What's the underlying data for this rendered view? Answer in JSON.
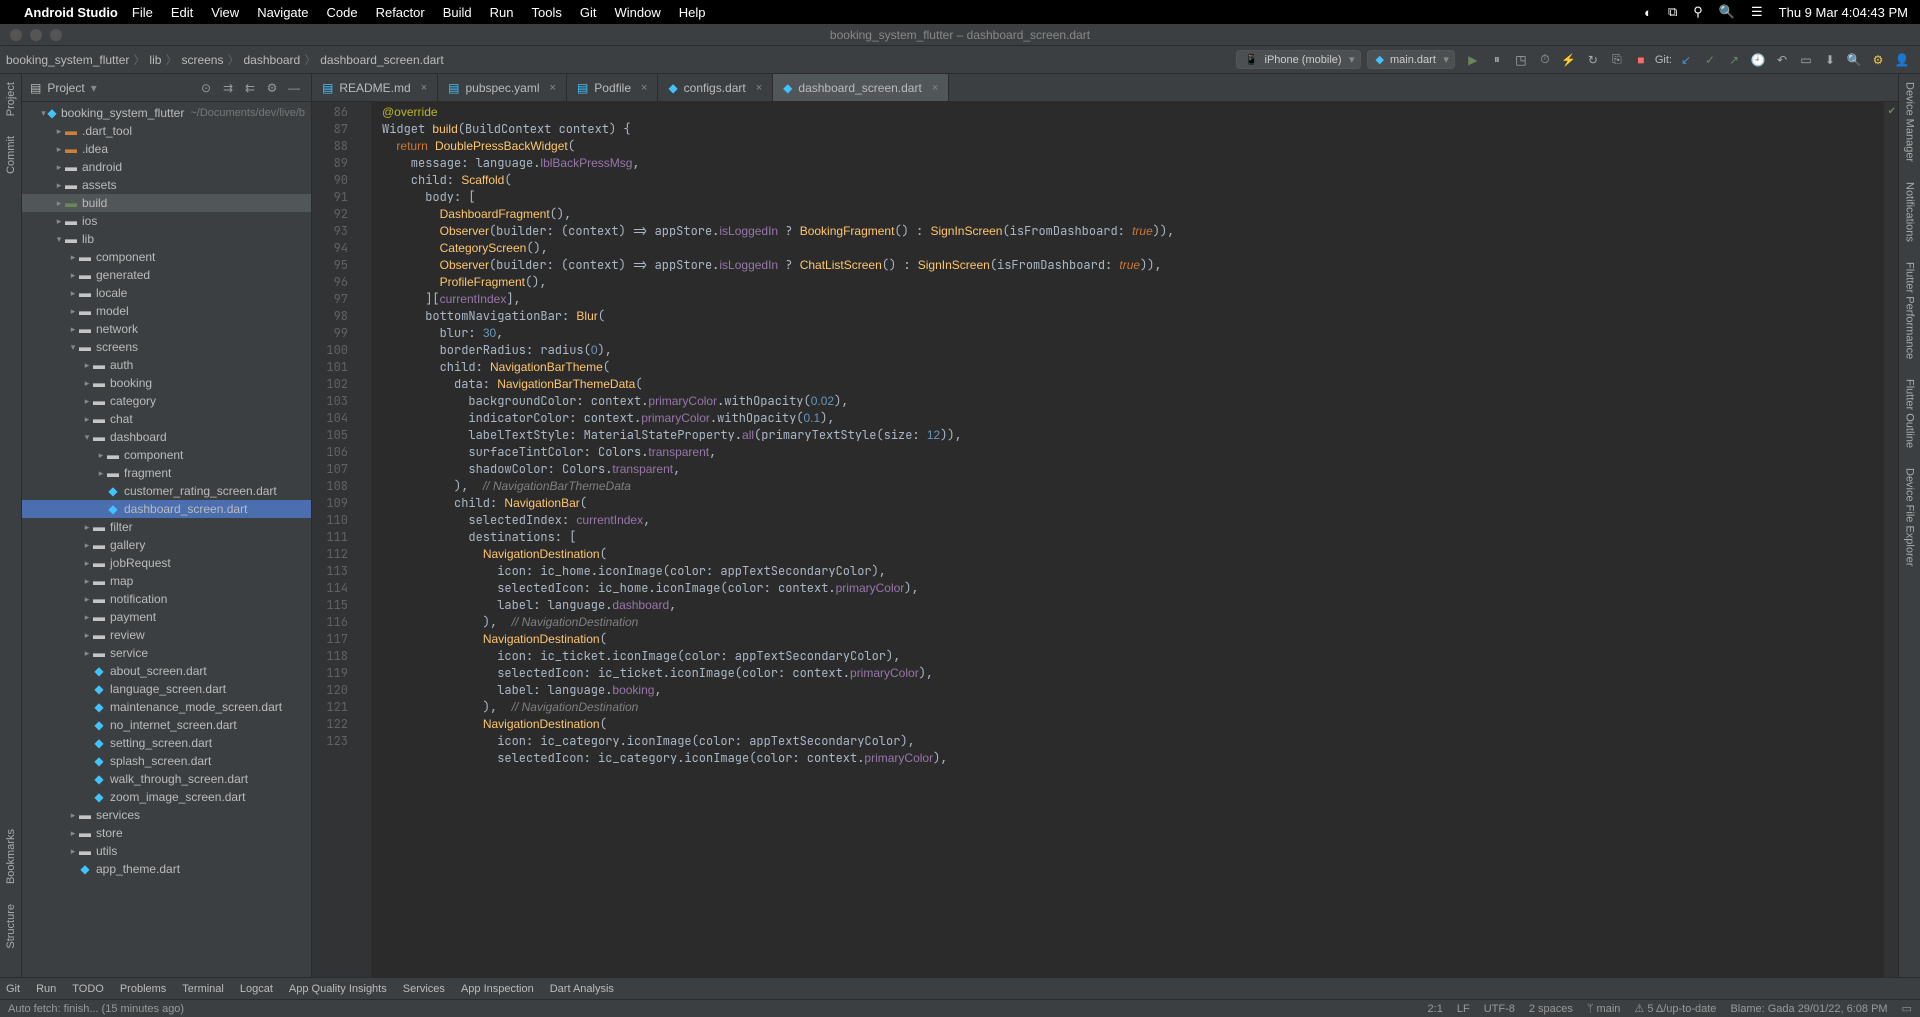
{
  "menubar": {
    "appname": "Android Studio",
    "items": [
      "File",
      "Edit",
      "View",
      "Navigate",
      "Code",
      "Refactor",
      "Build",
      "Run",
      "Tools",
      "Git",
      "Window",
      "Help"
    ],
    "clock": "Thu 9 Mar 4:04:43 PM"
  },
  "window_title": "booking_system_flutter – dashboard_screen.dart",
  "breadcrumbs": [
    "booking_system_flutter",
    "lib",
    "screens",
    "dashboard",
    "dashboard_screen.dart"
  ],
  "device_selector": "iPhone (mobile)",
  "config_selector": "main.dart",
  "git_label": "Git:",
  "left_tool_labels": [
    "Project",
    "Commit"
  ],
  "right_tool_labels": [
    "Device Manager",
    "Notifications",
    "Flutter Performance",
    "Flutter Outline",
    "Device File Explorer"
  ],
  "project_panel": {
    "title": "Project",
    "root_name": "booking_system_flutter",
    "root_path": "~/Documents/dev/live/b",
    "tree": [
      {
        "depth": 1,
        "arrow": "▾",
        "icon": "flutter",
        "name": "booking_system_flutter",
        "path": "~/Documents/dev/live/b"
      },
      {
        "depth": 2,
        "arrow": "▸",
        "icon": "folder-o",
        "name": ".dart_tool"
      },
      {
        "depth": 2,
        "arrow": "▸",
        "icon": "folder-o",
        "name": ".idea"
      },
      {
        "depth": 2,
        "arrow": "▸",
        "icon": "folder",
        "name": "android"
      },
      {
        "depth": 2,
        "arrow": "▸",
        "icon": "folder",
        "name": "assets"
      },
      {
        "depth": 2,
        "arrow": "▸",
        "icon": "folder-g",
        "name": "build",
        "hl": true
      },
      {
        "depth": 2,
        "arrow": "▸",
        "icon": "folder",
        "name": "ios"
      },
      {
        "depth": 2,
        "arrow": "▾",
        "icon": "folder",
        "name": "lib"
      },
      {
        "depth": 3,
        "arrow": "▸",
        "icon": "folder",
        "name": "component"
      },
      {
        "depth": 3,
        "arrow": "▸",
        "icon": "folder",
        "name": "generated"
      },
      {
        "depth": 3,
        "arrow": "▸",
        "icon": "folder",
        "name": "locale"
      },
      {
        "depth": 3,
        "arrow": "▸",
        "icon": "folder",
        "name": "model"
      },
      {
        "depth": 3,
        "arrow": "▸",
        "icon": "folder",
        "name": "network"
      },
      {
        "depth": 3,
        "arrow": "▾",
        "icon": "folder",
        "name": "screens"
      },
      {
        "depth": 4,
        "arrow": "▸",
        "icon": "folder",
        "name": "auth"
      },
      {
        "depth": 4,
        "arrow": "▸",
        "icon": "folder",
        "name": "booking"
      },
      {
        "depth": 4,
        "arrow": "▸",
        "icon": "folder",
        "name": "category"
      },
      {
        "depth": 4,
        "arrow": "▸",
        "icon": "folder",
        "name": "chat"
      },
      {
        "depth": 4,
        "arrow": "▾",
        "icon": "folder",
        "name": "dashboard"
      },
      {
        "depth": 5,
        "arrow": "▸",
        "icon": "folder",
        "name": "component"
      },
      {
        "depth": 5,
        "arrow": "▸",
        "icon": "folder",
        "name": "fragment"
      },
      {
        "depth": 5,
        "arrow": " ",
        "icon": "dart",
        "name": "customer_rating_screen.dart"
      },
      {
        "depth": 5,
        "arrow": " ",
        "icon": "dart",
        "name": "dashboard_screen.dart",
        "selected": true
      },
      {
        "depth": 4,
        "arrow": "▸",
        "icon": "folder",
        "name": "filter"
      },
      {
        "depth": 4,
        "arrow": "▸",
        "icon": "folder",
        "name": "gallery"
      },
      {
        "depth": 4,
        "arrow": "▸",
        "icon": "folder",
        "name": "jobRequest"
      },
      {
        "depth": 4,
        "arrow": "▸",
        "icon": "folder",
        "name": "map"
      },
      {
        "depth": 4,
        "arrow": "▸",
        "icon": "folder",
        "name": "notification"
      },
      {
        "depth": 4,
        "arrow": "▸",
        "icon": "folder",
        "name": "payment"
      },
      {
        "depth": 4,
        "arrow": "▸",
        "icon": "folder",
        "name": "review"
      },
      {
        "depth": 4,
        "arrow": "▸",
        "icon": "folder",
        "name": "service"
      },
      {
        "depth": 4,
        "arrow": " ",
        "icon": "dart",
        "name": "about_screen.dart"
      },
      {
        "depth": 4,
        "arrow": " ",
        "icon": "dart",
        "name": "language_screen.dart"
      },
      {
        "depth": 4,
        "arrow": " ",
        "icon": "dart",
        "name": "maintenance_mode_screen.dart"
      },
      {
        "depth": 4,
        "arrow": " ",
        "icon": "dart",
        "name": "no_internet_screen.dart"
      },
      {
        "depth": 4,
        "arrow": " ",
        "icon": "dart",
        "name": "setting_screen.dart"
      },
      {
        "depth": 4,
        "arrow": " ",
        "icon": "dart",
        "name": "splash_screen.dart"
      },
      {
        "depth": 4,
        "arrow": " ",
        "icon": "dart",
        "name": "walk_through_screen.dart"
      },
      {
        "depth": 4,
        "arrow": " ",
        "icon": "dart",
        "name": "zoom_image_screen.dart"
      },
      {
        "depth": 3,
        "arrow": "▸",
        "icon": "folder",
        "name": "services"
      },
      {
        "depth": 3,
        "arrow": "▸",
        "icon": "folder",
        "name": "store"
      },
      {
        "depth": 3,
        "arrow": "▸",
        "icon": "folder",
        "name": "utils"
      },
      {
        "depth": 3,
        "arrow": " ",
        "icon": "dart",
        "name": "app_theme.dart"
      }
    ]
  },
  "editor_tabs": [
    {
      "label": "README.md",
      "icon": "md"
    },
    {
      "label": "pubspec.yaml",
      "icon": "yaml"
    },
    {
      "label": "Podfile",
      "icon": "file"
    },
    {
      "label": "configs.dart",
      "icon": "dart"
    },
    {
      "label": "dashboard_screen.dart",
      "icon": "dart",
      "active": true
    }
  ],
  "line_start": 86,
  "line_end": 123,
  "bottom_tabs": [
    "Git",
    "Run",
    "TODO",
    "Problems",
    "Terminal",
    "Logcat",
    "App Quality Insights",
    "Services",
    "App Inspection",
    "Dart Analysis"
  ],
  "status_left": "Auto fetch: finish... (15 minutes ago)",
  "status": {
    "pos": "2:1",
    "lineend": "LF",
    "enc": "UTF-8",
    "indent": "2 spaces",
    "branch": "main",
    "warns": "5 Δ/up-to-date",
    "blame": "Blame: Gada 29/01/22, 6:08 PM"
  },
  "left_vlabels": {
    "bookmarks": "Bookmarks",
    "structure": "Structure"
  }
}
